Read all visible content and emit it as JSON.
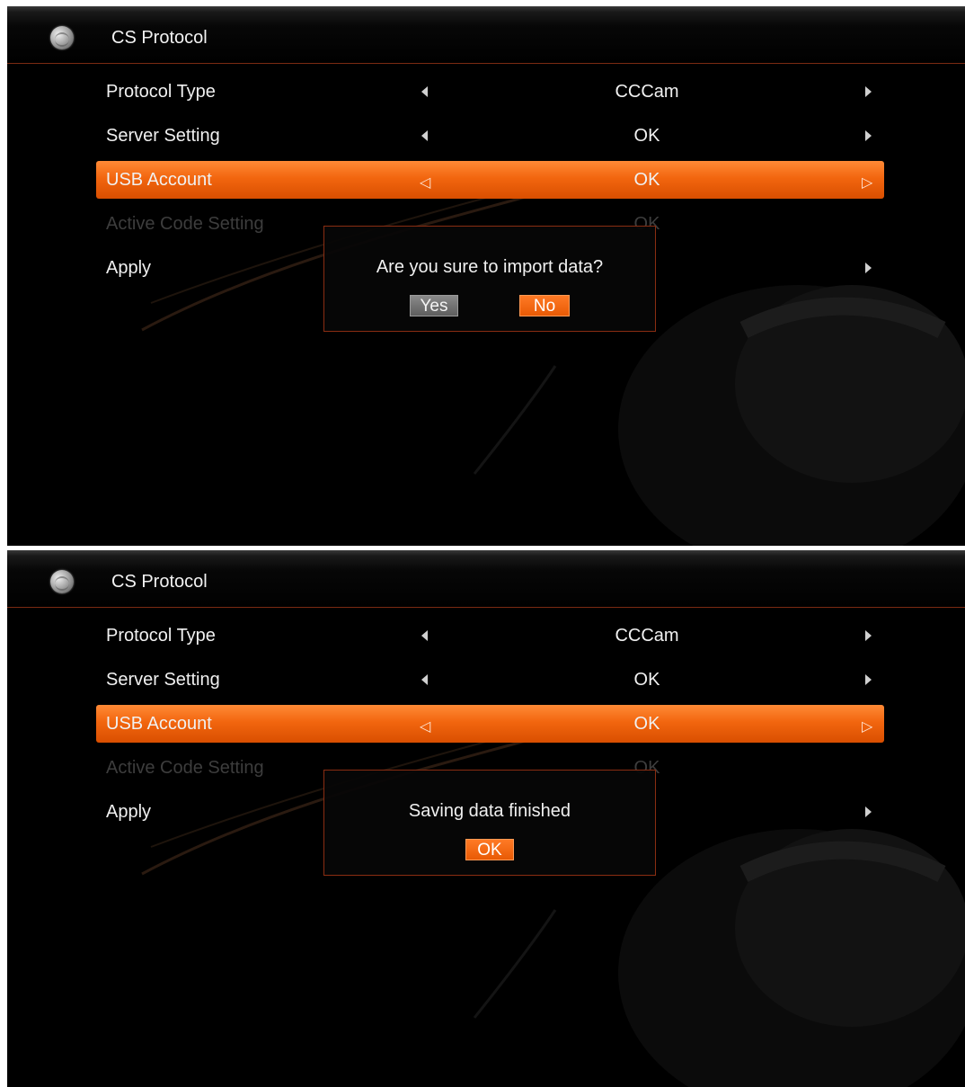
{
  "screens": [
    {
      "header": {
        "title": "CS Protocol"
      },
      "menu": [
        {
          "label": "Protocol Type",
          "value": "CCCam"
        },
        {
          "label": "Server Setting",
          "value": "OK"
        },
        {
          "label": "USB Account",
          "value": "OK"
        },
        {
          "label": "Active Code Setting",
          "value": "OK"
        },
        {
          "label": "Apply",
          "value": ""
        }
      ],
      "dialog": {
        "message": "Are you sure to import data?",
        "yes_label": "Yes",
        "no_label": "No"
      }
    },
    {
      "header": {
        "title": "CS Protocol"
      },
      "menu": [
        {
          "label": "Protocol Type",
          "value": "CCCam"
        },
        {
          "label": "Server Setting",
          "value": "OK"
        },
        {
          "label": "USB Account",
          "value": "OK"
        },
        {
          "label": "Active Code Setting",
          "value": "OK"
        },
        {
          "label": "Apply",
          "value": ""
        }
      ],
      "dialog": {
        "message": "Saving data finished",
        "ok_label": "OK"
      }
    }
  ],
  "colors": {
    "accent": "#f2660f",
    "disabled_text": "#3d3d3d",
    "dialog_border": "#8a2d12",
    "yes_button": "#6e6e6e"
  }
}
